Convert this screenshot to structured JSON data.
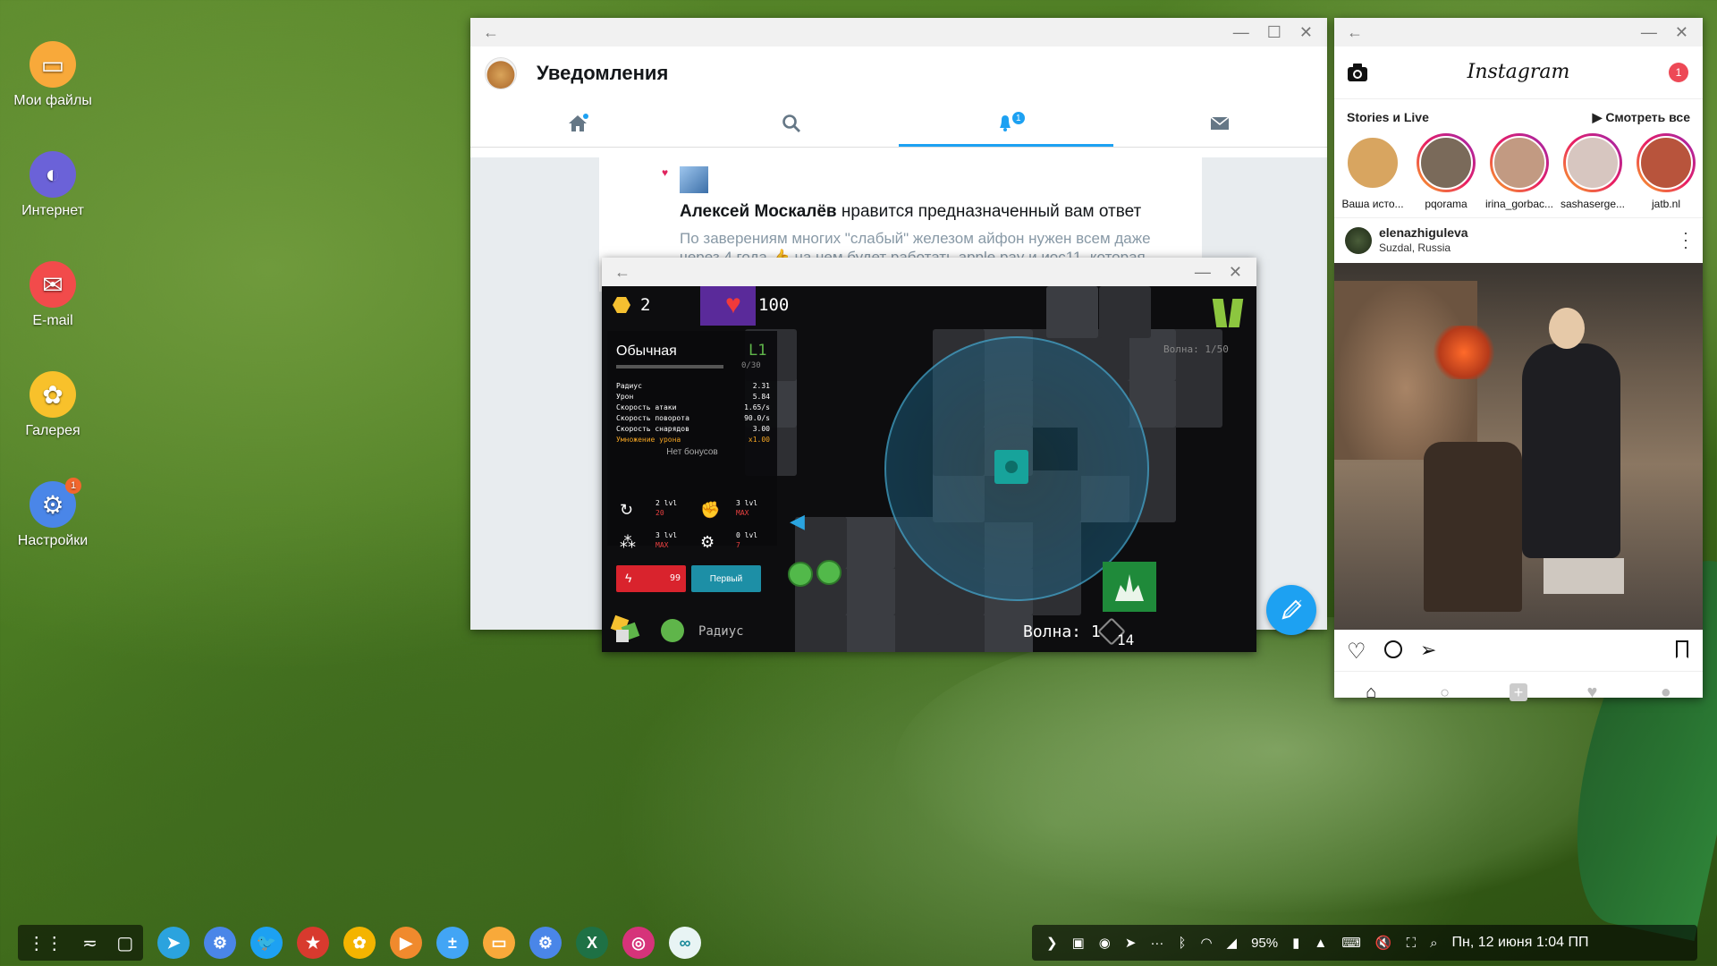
{
  "desktop": {
    "icons": [
      {
        "label": "Мои файлы",
        "color": "#f8a93a",
        "icon": "folder-icon"
      },
      {
        "label": "Интернет",
        "color": "#6b62d8",
        "icon": "planet-icon"
      },
      {
        "label": "E-mail",
        "color": "#f24b4b",
        "icon": "mail-icon"
      },
      {
        "label": "Галерея",
        "color": "#f8c12b",
        "icon": "flower-icon"
      },
      {
        "label": "Настройки",
        "color": "#4a86e8",
        "icon": "gear-icon",
        "badge": "1"
      }
    ]
  },
  "twitter": {
    "title": "Уведомления",
    "tabs": [
      {
        "name": "home",
        "icon": "home-icon"
      },
      {
        "name": "search",
        "icon": "search-icon"
      },
      {
        "name": "notifications",
        "icon": "bell-icon",
        "badge": "1",
        "active": true
      },
      {
        "name": "messages",
        "icon": "envelope-icon"
      }
    ],
    "notification": {
      "author": "Алексей Москалёв",
      "action": " нравится предназначенный вам ответ",
      "text": "По заверениям многих \"слабый\" железом айфон нужен всем даже через 4 года 👍 на нем будет работать apple pay и иос11, которая"
    }
  },
  "game": {
    "coins": "2",
    "health": "100",
    "tower_title": "Обычная",
    "tower_level": "L1",
    "tower_xp": "0/30",
    "stats": [
      {
        "label": "Радиус",
        "value": "2.31"
      },
      {
        "label": "Урон",
        "value": "5.84"
      },
      {
        "label": "Скорость атаки",
        "value": "1.65/s"
      },
      {
        "label": "Скорость поворота",
        "value": "90.0/s"
      },
      {
        "label": "Скорость снарядов",
        "value": "3.00"
      },
      {
        "label": "Умножение урона",
        "value": "x1.00",
        "highlight": true
      }
    ],
    "no_bonus": "Нет бонусов",
    "upgrades": [
      {
        "lvl": "2 lvl",
        "cost": "20"
      },
      {
        "lvl": "3 lvl",
        "cost": "MAX"
      },
      {
        "lvl": "3 lvl",
        "cost": "MAX"
      },
      {
        "lvl": "0 lvl",
        "cost": "7"
      }
    ],
    "sell_value": "99",
    "target_mode": "Первый",
    "wave_small": "Волна: 1/50",
    "bottom_label": "Радиус",
    "wave": "Волна: 1",
    "enemies": "14"
  },
  "instagram": {
    "logo": "Instagram",
    "badge": "1",
    "stories_title": "Stories и Live",
    "watch_all": "▶ Смотреть все",
    "stories": [
      {
        "name": "Ваша исто...",
        "own": true
      },
      {
        "name": "pqorama"
      },
      {
        "name": "irina_gorbac..."
      },
      {
        "name": "sashaserge..."
      },
      {
        "name": "jatb.nl"
      }
    ],
    "post_user": "elenazhiguleva",
    "post_location": "Suzdal, Russia"
  },
  "taskbar": {
    "apps": [
      {
        "name": "telegram",
        "color": "#2ba3de",
        "glyph": "➤"
      },
      {
        "name": "settings",
        "color": "#4a86e8",
        "glyph": "⚙"
      },
      {
        "name": "twitter",
        "color": "#1da1f2",
        "glyph": "🐦"
      },
      {
        "name": "bookmark",
        "color": "#d83a2e",
        "glyph": "★"
      },
      {
        "name": "photos",
        "color": "#f4b400",
        "glyph": "✿"
      },
      {
        "name": "player",
        "color": "#f08a2d",
        "glyph": "▶"
      },
      {
        "name": "calculator",
        "color": "#42a5f5",
        "glyph": "±"
      },
      {
        "name": "files",
        "color": "#f8a93a",
        "glyph": "▭"
      },
      {
        "name": "settings2",
        "color": "#4a86e8",
        "glyph": "⚙"
      },
      {
        "name": "excel",
        "color": "#1e7145",
        "glyph": "X"
      },
      {
        "name": "instagram",
        "color": "#d6337a",
        "glyph": "◎"
      },
      {
        "name": "infinity",
        "color": "#e8f4f4",
        "glyph": "∞"
      }
    ],
    "battery": "95%",
    "datetime": "Пн, 12 июня 1:04 ПП"
  }
}
